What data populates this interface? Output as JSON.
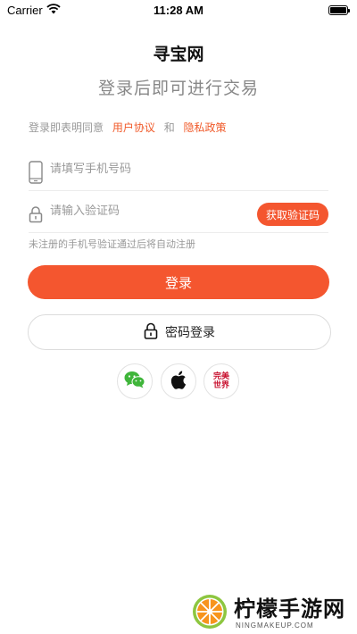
{
  "status_bar": {
    "carrier": "Carrier",
    "time": "11:28 AM"
  },
  "header": {
    "app_title": "寻宝网",
    "subtitle": "登录后即可进行交易"
  },
  "agreement": {
    "prefix": "登录即表明同意",
    "user_agreement": "用户协议",
    "and": "和",
    "privacy_policy": "隐私政策"
  },
  "form": {
    "phone_placeholder": "请填写手机号码",
    "phone_value": "",
    "code_placeholder": "请输入验证码",
    "code_value": "",
    "get_code_label": "获取验证码",
    "hint": "未注册的手机号验证通过后将自动注册"
  },
  "buttons": {
    "login": "登录",
    "password_login": "密码登录"
  },
  "social": {
    "items": [
      "wechat-icon",
      "apple-icon",
      "wanmei-icon"
    ],
    "wanmei_logo_text": "完美世界"
  },
  "watermark": {
    "name": "柠檬手游网",
    "url": "NINGMAKEUP.COM"
  },
  "colors": {
    "accent": "#f4562f",
    "link": "#f05a2a",
    "wechat": "#3fb53a",
    "wanmei": "#c8102e"
  }
}
